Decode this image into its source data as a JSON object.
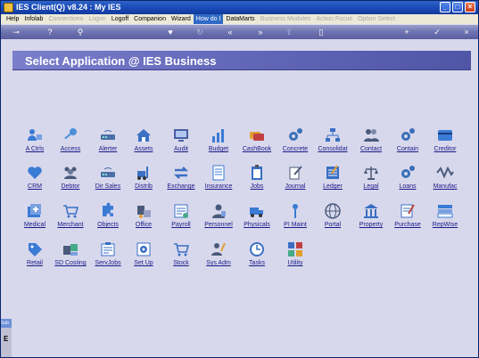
{
  "window": {
    "title": "IES Client(Q) v8.24 : My IES"
  },
  "titlebar_buttons": [
    "_",
    "□",
    "×"
  ],
  "menu": [
    {
      "label": "Help",
      "state": "normal"
    },
    {
      "label": "Infolab",
      "state": "normal"
    },
    {
      "label": "Connections",
      "state": "disabled"
    },
    {
      "label": "Logon",
      "state": "disabled"
    },
    {
      "label": "Logoff",
      "state": "normal"
    },
    {
      "label": "Companion",
      "state": "normal"
    },
    {
      "label": "Wizard",
      "state": "normal"
    },
    {
      "label": "How do I",
      "state": "active"
    },
    {
      "label": "DataMarts",
      "state": "normal"
    },
    {
      "label": "Business Modules",
      "state": "disabled"
    },
    {
      "label": "Action Focus",
      "state": "disabled"
    },
    {
      "label": "Option Select",
      "state": "disabled"
    }
  ],
  "toolbar": {
    "icons": [
      "key-icon",
      "help-icon",
      "search-icon",
      "heart-icon",
      "refresh-icon",
      "rewind-icon",
      "fast-forward-icon",
      "upload-icon",
      "document-icon",
      "plus-icon",
      "check-icon",
      "close-icon"
    ]
  },
  "banner": {
    "title": "Select Application @ IES Business"
  },
  "sidebar": {
    "tab_label": "Sub",
    "indicator": "E"
  },
  "apps": [
    {
      "label": "A Ctrls",
      "icon": "people-icon",
      "color": "#3a7bd5"
    },
    {
      "label": "Access",
      "icon": "key-icon",
      "color": "#4a8fd8"
    },
    {
      "label": "Alerter",
      "icon": "router-icon",
      "color": "#4a6fa8"
    },
    {
      "label": "Assets",
      "icon": "house-icon",
      "color": "#3a6fc4"
    },
    {
      "label": "Audit",
      "icon": "monitor-icon",
      "color": "#4a5fa4"
    },
    {
      "label": "Budget",
      "icon": "bar-chart-icon",
      "color": "#3a7bd5"
    },
    {
      "label": "CashBook",
      "icon": "cards-icon",
      "color": "#c04040"
    },
    {
      "label": "Concrete",
      "icon": "gears-icon",
      "color": "#3a6fb8"
    },
    {
      "label": "Consolidat",
      "icon": "org-chart-icon",
      "color": "#3a6fc4"
    },
    {
      "label": "Contact",
      "icon": "contacts-icon",
      "color": "#4a5a7a"
    },
    {
      "label": "Contain",
      "icon": "gears-icon",
      "color": "#3a6fb8"
    },
    {
      "label": "Creditor",
      "icon": "card-icon",
      "color": "#3a7bd5"
    },
    {
      "label": "CRM",
      "icon": "heart-icon",
      "color": "#3a7bd5"
    },
    {
      "label": "Debtor",
      "icon": "group-icon",
      "color": "#4a5a7a"
    },
    {
      "label": "Dir Sales",
      "icon": "router-icon",
      "color": "#4a6fa8"
    },
    {
      "label": "Distrib",
      "icon": "forklift-icon",
      "color": "#3a6fc4"
    },
    {
      "label": "Exchange",
      "icon": "exchange-icon",
      "color": "#3a6fc4"
    },
    {
      "label": "Insurance",
      "icon": "document-icon",
      "color": "#3a7bd5"
    },
    {
      "label": "Jobs",
      "icon": "clipboard-icon",
      "color": "#3a6fc4"
    },
    {
      "label": "Journal",
      "icon": "pen-icon",
      "color": "#4a5a7a"
    },
    {
      "label": "Ledger",
      "icon": "ledger-icon",
      "color": "#3a6fc4"
    },
    {
      "label": "Legal",
      "icon": "scales-icon",
      "color": "#4a5a7a"
    },
    {
      "label": "Loans",
      "icon": "gears-icon",
      "color": "#3a6fb8"
    },
    {
      "label": "Manufac",
      "icon": "wave-icon",
      "color": "#4a5a7a"
    },
    {
      "label": "Medical",
      "icon": "medical-icon",
      "color": "#3a7bd5"
    },
    {
      "label": "Merchant",
      "icon": "cart-icon",
      "color": "#3a6fc4"
    },
    {
      "label": "Objects",
      "icon": "puzzle-icon",
      "color": "#3a7bd5"
    },
    {
      "label": "Office",
      "icon": "office-icon",
      "color": "#4a5a7a"
    },
    {
      "label": "Payroll",
      "icon": "payroll-icon",
      "color": "#3a6fc4"
    },
    {
      "label": "Personnel",
      "icon": "person-icon",
      "color": "#4a5a7a"
    },
    {
      "label": "Physicals",
      "icon": "truck-icon",
      "color": "#3a7bd5"
    },
    {
      "label": "PI Maint",
      "icon": "pin-icon",
      "color": "#3a7bd5"
    },
    {
      "label": "Portal",
      "icon": "globe-icon",
      "color": "#4a5a7a"
    },
    {
      "label": "Property",
      "icon": "building-icon",
      "color": "#3a6fc4"
    },
    {
      "label": "Purchase",
      "icon": "purchase-icon",
      "color": "#3a6fc4"
    },
    {
      "label": "RepWise",
      "icon": "report-icon",
      "color": "#3a7bd5"
    },
    {
      "label": "Retail",
      "icon": "tag-icon",
      "color": "#3a7bd5"
    },
    {
      "label": "SD Costing",
      "icon": "costing-icon",
      "color": "#4a5a7a"
    },
    {
      "label": "ServJobs",
      "icon": "servjobs-icon",
      "color": "#3a6fc4"
    },
    {
      "label": "Set Up",
      "icon": "setup-icon",
      "color": "#3a6fc4"
    },
    {
      "label": "Stock",
      "icon": "cart-icon",
      "color": "#3a6fc4"
    },
    {
      "label": "Sys Adm",
      "icon": "admin-icon",
      "color": "#4a5a7a"
    },
    {
      "label": "Tasks",
      "icon": "clock-icon",
      "color": "#3a6fc4"
    },
    {
      "label": "Utility",
      "icon": "utility-icon",
      "color": "#3a6fc4"
    }
  ]
}
